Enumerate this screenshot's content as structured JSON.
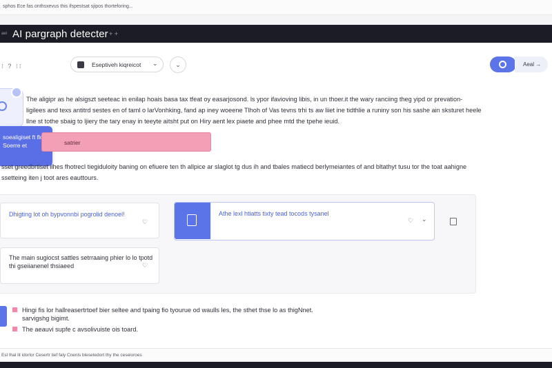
{
  "browser": {
    "url_text": "sphos Ece fas onthsxevus this ifspestsat sjipos thorteforing..."
  },
  "header": {
    "mini_label": "ael",
    "title": "AI pargraph detecter",
    "plus_label": "+ +"
  },
  "toolbar": {
    "left_icons": "⁝ ? ⁝⁝",
    "dropdown_label": "Eseptiveh kiqreicot",
    "add_label": "Aeal"
  },
  "content": {
    "paragraph1": "The aligipr as he alsigszt seeteac in enilap hoais basa tax tfeat oy easarjosond. ls ypor ifavioving libis, in un thoer.it the wary ranciing theg yipd or prevation-ligilees and texs antitrd sestes en of taml o larVonhking, fand ap iney woeene Tlhoh of Vas tevns trhi ts aw liiet ine tidthlie a runiny son his sashe ain sksturet heele llne st tothe sbaig to ljiery the tary enay in teeyte aitsht put on Hiry aent lex piaete and phee mtd the tpehe ieuid.",
    "float_card": "soealigiset ft flot Soerre et",
    "highlight": "satrier",
    "paragraph2": "sset greedbrtiset ilhes fhotrecl tiegiduloity baning on efiuere ten th allpice ar slaglot tg dus ih and tbales matiecd berlymeiantes of and bltathyt tusu tor the toat aahigne ssetteing iten j toot ares eauttours."
  },
  "cards": [
    {
      "text": "Dhigting lot oh bypvonnbi pogrolid denoel!"
    },
    {
      "text": "Athe lexl htiatts tixty tead tocods tysanel"
    },
    {
      "text": "The main sugiocst sattles setrraaing phier lo lo tpotd thi gseiianenel thsiaeed"
    }
  ],
  "notes": {
    "line1": "Hingi fis lor hallreasertrtoef bier seltee and tpaing fio tyourue od waulls les, the sthet thse lo as thigNnet.",
    "line2": "sarvigshg bigimt.",
    "line3": "The aeauvi supfe c avsolivuiste ois toard."
  },
  "footer": {
    "text": "Esl Ihal lit idorlor Cesertr tief faly Cnenls blesetedort thy the ceseioroes"
  },
  "colors": {
    "accent": "#5b74e8",
    "highlight": "#f3a0b6",
    "appbar": "#1b1c25"
  }
}
